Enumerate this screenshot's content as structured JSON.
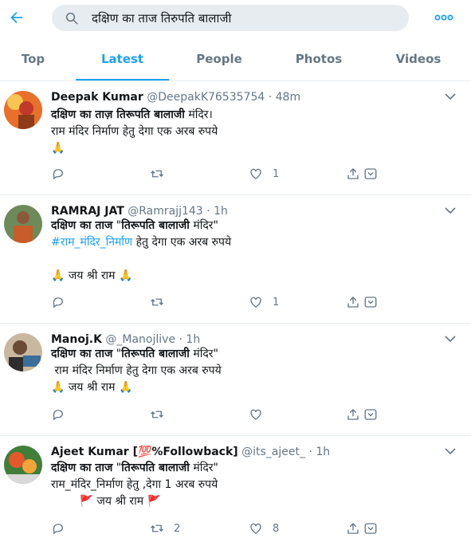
{
  "search": {
    "query": "दक्षिण का ताज तिरुपति बालाजी"
  },
  "tabs": [
    {
      "label": "Top"
    },
    {
      "label": "Latest"
    },
    {
      "label": "People"
    },
    {
      "label": "Photos"
    },
    {
      "label": "Videos"
    }
  ],
  "active_tab": "Latest",
  "tweets": [
    {
      "name": "Deepak Kumar",
      "handle": "@DeepakK76535754",
      "sep": "·",
      "time": "48m",
      "text_bold": "दक्षिण का ताज़ तिरूपति बालाजी",
      "text_rest": " मंदिर।",
      "line2": "राम मंदिर निर्माण हेतु देगा एक अरब रुपये",
      "line3": "🙏",
      "replies": "",
      "retweets": "",
      "likes": "1"
    },
    {
      "name": "RAMRAJ JAT",
      "handle": "@Ramrajj143",
      "sep": "·",
      "time": "1h",
      "text_bold": "दक्षिण का ताज",
      "text_mid": " \"",
      "text_bold2": "तिरूपति बालाजी",
      "text_rest": " मंदिर\"",
      "hashtag": "#राम_मंदिर_निर्माण",
      "line2_rest": " हेतु देगा एक अरब रुपये",
      "line4": "🙏 जय श्री राम 🙏",
      "replies": "",
      "retweets": "",
      "likes": "1"
    },
    {
      "name": "Manoj.K",
      "handle": "@_Manojlive",
      "sep": "·",
      "time": "1h",
      "text_bold": "दक्षिण का ताज",
      "text_mid": " \"",
      "text_bold2": "तिरूपति बालाजी",
      "text_rest": " मंदिर\"",
      "line2": " राम मंदिर निर्माण हेतु देगा एक अरब रुपये",
      "line3": "🙏 जय श्री राम 🙏",
      "replies": "",
      "retweets": "",
      "likes": ""
    },
    {
      "name": "Ajeet Kumar [💯%Followback]",
      "handle": "@its_ajeet_",
      "sep": "·",
      "time": "1h",
      "text_bold": "दक्षिण का ताज",
      "text_mid": " \"",
      "text_bold2": "तिरूपति बालाजी",
      "text_rest": " मंदिर\"",
      "line2": "राम_मंदिर_निर्माण हेतु ,देगा 1 अरब रुपये",
      "line3": "        🚩 जय श्री राम 🚩",
      "replies": "",
      "retweets": "2",
      "likes": "8"
    }
  ],
  "colors": {
    "accent": "#1da1f2",
    "muted": "#657786",
    "divider": "#e6ecf0"
  },
  "icons": [
    "back-arrow-icon",
    "search-icon",
    "more-icon",
    "caret-down-icon",
    "reply-icon",
    "retweet-icon",
    "like-icon",
    "share-icon",
    "save-icon"
  ]
}
